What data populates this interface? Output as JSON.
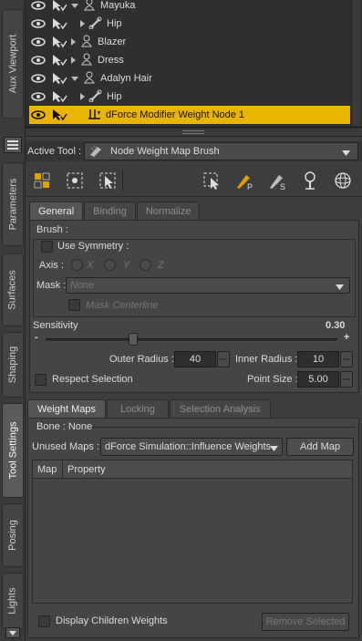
{
  "sidebar": {
    "tabs": [
      "Aux Viewport",
      "Parameters",
      "Surfaces",
      "Shaping",
      "Tool Settings",
      "Posing",
      "Lights"
    ],
    "active": "Tool Settings"
  },
  "scene": {
    "rows": [
      {
        "label": "Mayuka",
        "icon": "figure-icon",
        "expand": "expanded"
      },
      {
        "label": "Hip",
        "icon": "bone-icon",
        "expand": "collapsed"
      },
      {
        "label": "Blazer",
        "icon": "figure-icon",
        "expand": "collapsed"
      },
      {
        "label": "Dress",
        "icon": "figure-icon",
        "expand": "collapsed"
      },
      {
        "label": "Adalyn Hair",
        "icon": "figure-icon",
        "expand": "expanded"
      },
      {
        "label": "Hip",
        "icon": "bone-icon",
        "expand": "collapsed"
      },
      {
        "label": "dForce Modifier Weight Node 1",
        "icon": "weight-node-icon",
        "expand": "none",
        "selected": true
      }
    ]
  },
  "active_tool": {
    "label": "Active Tool :",
    "value": "Node Weight Map Brush"
  },
  "toolbar": {
    "icons": [
      "select-icon",
      "node-select-icon",
      "region-select-icon",
      "weight-map-icon",
      "paint-brush-icon",
      "smooth-brush-icon",
      "probe-icon",
      "sphere-icon"
    ]
  },
  "tool_tabs": [
    "General",
    "Binding",
    "Normalize"
  ],
  "brush": {
    "title": "Brush :",
    "use_symmetry": "Use Symmetry :",
    "axis_label": "Axis :",
    "axes": [
      "X",
      "Y",
      "Z"
    ],
    "mask_label": "Mask :",
    "mask_value": "None",
    "mask_centerline": "Mask Centerline",
    "sensitivity_label": "Sensitivity",
    "sensitivity_value": "0.30",
    "sensitivity_fraction": 0.3,
    "outer_radius_label": "Outer Radius :",
    "outer_radius": "40",
    "inner_radius_label": "Inner Radius :",
    "inner_radius": "10",
    "respect_selection": "Respect Selection",
    "point_size_label": "Point Size :",
    "point_size": "5.00"
  },
  "map_tabs": [
    "Weight Maps",
    "Locking",
    "Selection Analysis"
  ],
  "weight_maps": {
    "bone": "Bone : None",
    "unused_label": "Unused Maps :",
    "unused_value": "dForce Simulation::Influence Weights",
    "add_map": "Add Map",
    "columns": [
      "Map",
      "Property"
    ],
    "display_children": "Display Children Weights",
    "remove_selected": "Remove Selected"
  }
}
